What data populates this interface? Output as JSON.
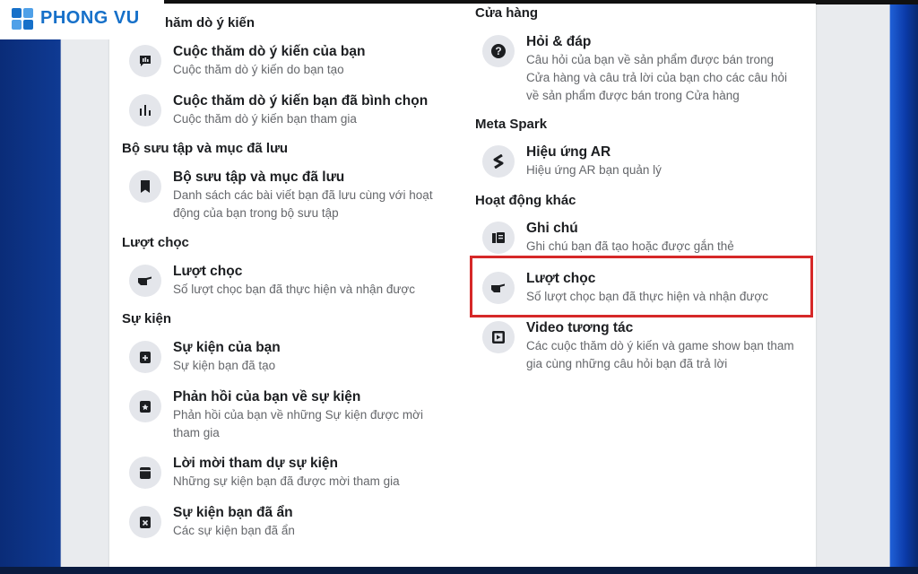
{
  "brand": {
    "logo_text": "PHONG VU"
  },
  "left": {
    "sections": [
      {
        "title": "hăm dò ý kiến",
        "items": [
          {
            "icon": "poll-chat-icon",
            "title": "Cuộc thăm dò ý kiến của bạn",
            "desc": "Cuộc thăm dò ý kiến do bạn tạo"
          },
          {
            "icon": "bar-chart-icon",
            "title": "Cuộc thăm dò ý kiến bạn đã bình chọn",
            "desc": "Cuộc thăm dò ý kiến bạn tham gia"
          }
        ]
      },
      {
        "title": "Bộ sưu tập và mục đã lưu",
        "items": [
          {
            "icon": "bookmark-icon",
            "title": "Bộ sưu tập và mục đã lưu",
            "desc": "Danh sách các bài viết bạn đã lưu cùng với hoạt động của bạn trong bộ sưu tập"
          }
        ]
      },
      {
        "title": "Lượt chọc",
        "items": [
          {
            "icon": "poke-hand-icon",
            "title": "Lượt chọc",
            "desc": "Số lượt chọc bạn đã thực hiện và nhận được"
          }
        ]
      },
      {
        "title": "Sự kiện",
        "items": [
          {
            "icon": "calendar-plus-icon",
            "title": "Sự kiện của bạn",
            "desc": "Sự kiện bạn đã tạo"
          },
          {
            "icon": "calendar-star-icon",
            "title": "Phản hồi của bạn về sự kiện",
            "desc": "Phản hồi của bạn về những Sự kiện được mời tham gia"
          },
          {
            "icon": "calendar-icon",
            "title": "Lời mời tham dự sự kiện",
            "desc": "Những sự kiện bạn đã được mời tham gia"
          },
          {
            "icon": "calendar-x-icon",
            "title": "Sự kiện bạn đã ẩn",
            "desc": "Các sự kiện bạn đã ẩn"
          }
        ]
      }
    ]
  },
  "right": {
    "sections": [
      {
        "title": "Cửa hàng",
        "items": [
          {
            "icon": "question-icon",
            "title": "Hỏi & đáp",
            "desc": "Câu hỏi của bạn về sản phẩm được bán trong Cửa hàng và câu trả lời của bạn cho các câu hỏi về sản phẩm được bán trong Cửa hàng"
          }
        ]
      },
      {
        "title": "Meta Spark",
        "items": [
          {
            "icon": "spark-ar-icon",
            "title": "Hiệu ứng AR",
            "desc": "Hiệu ứng AR bạn quản lý"
          }
        ]
      },
      {
        "title": "Hoạt động khác",
        "items": [
          {
            "icon": "notes-icon",
            "title": "Ghi chú",
            "desc": "Ghi chú bạn đã tạo hoặc được gắn thẻ"
          },
          {
            "icon": "poke-hand-icon",
            "title": "Lượt chọc",
            "desc": "Số lượt chọc bạn đã thực hiện và nhận được"
          },
          {
            "icon": "video-interactive-icon",
            "title": "Video tương tác",
            "desc": "Các cuộc thăm dò ý kiến và game show bạn tham gia cùng những câu hỏi bạn đã trả lời"
          }
        ]
      }
    ]
  },
  "colors": {
    "highlight": "#d62828",
    "brand": "#1670c9"
  }
}
